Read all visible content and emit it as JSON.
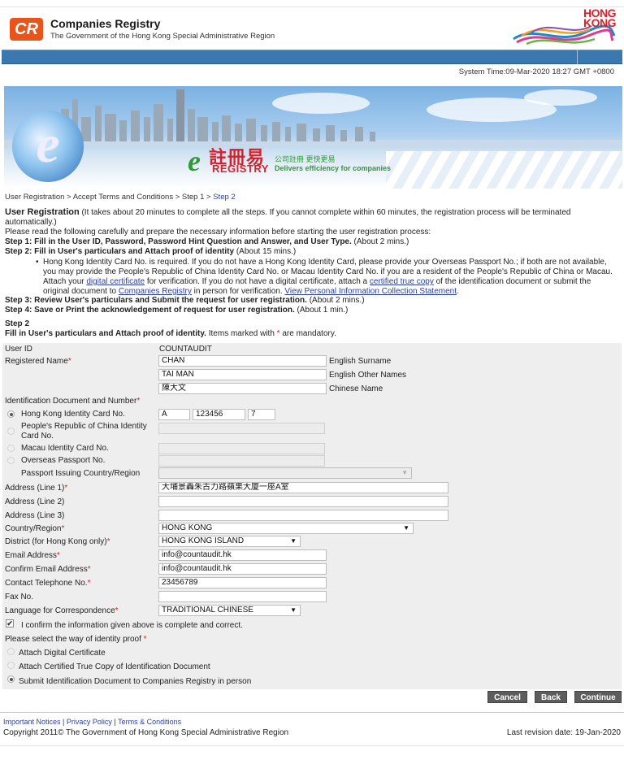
{
  "header": {
    "logo_text": "CR",
    "title": "Companies Registry",
    "subtitle": "The Government of the Hong Kong Special Administrative Region",
    "hk_logo_line1": "HONG",
    "hk_logo_line2": "KONG",
    "system_time": "System Time:09-Mar-2020 18:27 GMT +0800"
  },
  "banner": {
    "cn_name": "註冊易",
    "word": "REGISTRY",
    "tagline_cn": "公司註冊 更快更易",
    "tagline_en": "Delivers efficiency for companies"
  },
  "breadcrumb": {
    "items": [
      "User Registration",
      "Accept Terms and Conditions",
      "Step 1"
    ],
    "separator": " > ",
    "current": "Step 2"
  },
  "intro": {
    "title": "User Registration",
    "note": " (It takes about 20 minutes to complete all the steps. If you cannot complete within 60 minutes, the registration process will be terminated automatically.)",
    "read": "Please read the following carefully and prepare the necessary information before starting the user registration process:",
    "step1_bold": "Step 1: Fill in the User ID, Password, Password Hint Question and Answer, and User Type.",
    "step1_time": " (About 2 mins.)",
    "step2_bold": "Step 2: Fill in User's particulars and Attach proof of identity",
    "step2_time": " (About 15 mins.)",
    "bullet_a": "Hong Kong Identity Card No. is required. If you do not have a Hong Kong Identity Card, please provide your Overseas Passport No.; if both are not available, you may provide the People's Republic of China Identity Card No. or Macau Identity Card No. if you are a resident of the People's Republic of China or Macau. Attach your ",
    "link_digital_cert": "digital certificate",
    "bullet_b": " for verification. If you do not have a digital certificate, attach a ",
    "link_certified_copy": "certified true copy",
    "bullet_c": " of the identification document or submit the original document to ",
    "link_companies_registry": "Companies Registry",
    "bullet_d": " in person for verification. ",
    "link_pics": "View Personal Information Collection Statement",
    "bullet_e": ".",
    "step3_bold": "Step 3: Review User's particulars and Submit the request for user registration.",
    "step3_time": " (About 2 mins.)",
    "step4_bold": "Step 4: Save or Print the acknowledgement of request for user registration.",
    "step4_time": " (About 1 min.)"
  },
  "section": {
    "step": "Step 2",
    "heading_bold": "Fill in User's particulars and Attach proof of identity.",
    "heading_rest_a": " Items marked with ",
    "heading_star": "*",
    "heading_rest_b": " are mandatory."
  },
  "form": {
    "required_mark": "*",
    "user_id_label": "User ID",
    "user_id_value": "COUNTAUDIT",
    "registered_name_label": "Registered Name",
    "surname": "CHAN",
    "surname_caption": "English Surname",
    "other_names": "TAI MAN",
    "other_names_caption": "English Other Names",
    "chinese_name": "陳大文",
    "chinese_name_caption": "Chinese Name",
    "id_doc_label": "Identification Document and Number",
    "hkid_label": "Hong Kong Identity Card No.",
    "hkid_prefix": "A",
    "hkid_number": "123456",
    "hkid_check": "7",
    "prc_label_1": "People's Republic of China Identity",
    "prc_label_2": "Card No.",
    "macau_label": "Macau Identity Card No.",
    "passport_label": "Overseas Passport No.",
    "passport_country_label": "Passport Issuing Country/Region",
    "address1_label": "Address (Line 1)",
    "address1": "大埔景轟朱古力路蘋果大廈一座A室",
    "address2_label": "Address (Line 2)",
    "address3_label": "Address (Line 3)",
    "country_label": "Country/Region",
    "country": "HONG KONG",
    "district_label": "District (for Hong Kong only)",
    "district": "HONG KONG ISLAND",
    "email_label": "Email Address",
    "email": "info@countaudit.hk",
    "confirm_email_label": "Confirm Email Address",
    "confirm_email": "info@countaudit.hk",
    "phone_label": "Contact Telephone No.",
    "phone": "23456789",
    "fax_label": "Fax No.",
    "language_label": "Language for Correspondence",
    "language": "TRADITIONAL CHINESE",
    "confirm_text": "I confirm the information given above is complete and correct.",
    "proof_label": "Please select the way of identity proof ",
    "proof_opt1": "Attach Digital Certificate",
    "proof_opt2": "Attach Certified True Copy of Identification Document",
    "proof_opt3": "Submit Identification Document to Companies Registry in person"
  },
  "buttons": {
    "cancel": "Cancel",
    "back": "Back",
    "continue": "Continue"
  },
  "footer": {
    "important_notices": "Important Notices",
    "privacy_policy": "Privacy Policy",
    "terms": "Terms & Conditions",
    "sep": " | ",
    "copyright": "Copyright 2011© The Government of Hong Kong Special Administrative Region",
    "last_revision": "Last revision date: 19-Jan-2020"
  }
}
